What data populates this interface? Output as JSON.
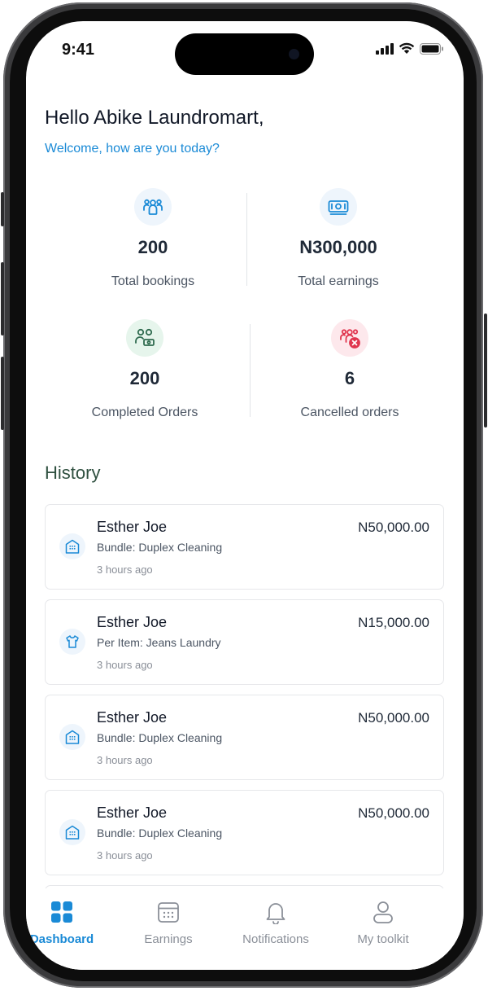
{
  "status_bar": {
    "time": "9:41"
  },
  "header": {
    "greeting": "Hello Abike Laundromart,",
    "welcome": "Welcome, how are you today?"
  },
  "stats": [
    {
      "value": "200",
      "label": "Total bookings",
      "icon": "users-icon",
      "color": "#1a8ad6"
    },
    {
      "value": "N300,000",
      "label": "Total earnings",
      "icon": "cash-icon",
      "color": "#1a8ad6"
    },
    {
      "value": "200",
      "label": "Completed Orders",
      "icon": "user-cash-icon",
      "color": "#2f6b4f"
    },
    {
      "value": "6",
      "label": "Cancelled orders",
      "icon": "users-cancel-icon",
      "color": "#e0364f"
    }
  ],
  "history": {
    "title": "History",
    "items": [
      {
        "name": "Esther Joe",
        "amount": "N50,000.00",
        "description": "Bundle: Duplex Cleaning",
        "time": "3 hours ago",
        "icon": "building-icon"
      },
      {
        "name": "Esther Joe",
        "amount": "N15,000.00",
        "description": "Per Item: Jeans Laundry",
        "time": "3 hours ago",
        "icon": "shirt-icon"
      },
      {
        "name": "Esther Joe",
        "amount": "N50,000.00",
        "description": "Bundle: Duplex Cleaning",
        "time": "3 hours ago",
        "icon": "building-icon"
      },
      {
        "name": "Esther Joe",
        "amount": "N50,000.00",
        "description": "Bundle: Duplex Cleaning",
        "time": "3 hours ago",
        "icon": "building-icon"
      }
    ]
  },
  "tabs": [
    {
      "label": "Dashboard",
      "icon": "grid-icon",
      "active": true
    },
    {
      "label": "Earnings",
      "icon": "calendar-icon",
      "active": false
    },
    {
      "label": "Notifications",
      "icon": "bell-icon",
      "active": false
    },
    {
      "label": "My toolkit",
      "icon": "user-icon",
      "active": false
    }
  ],
  "colors": {
    "accent": "#1a8ad6",
    "history_title": "#2f5040",
    "success": "#2f6b4f",
    "danger": "#e0364f"
  }
}
